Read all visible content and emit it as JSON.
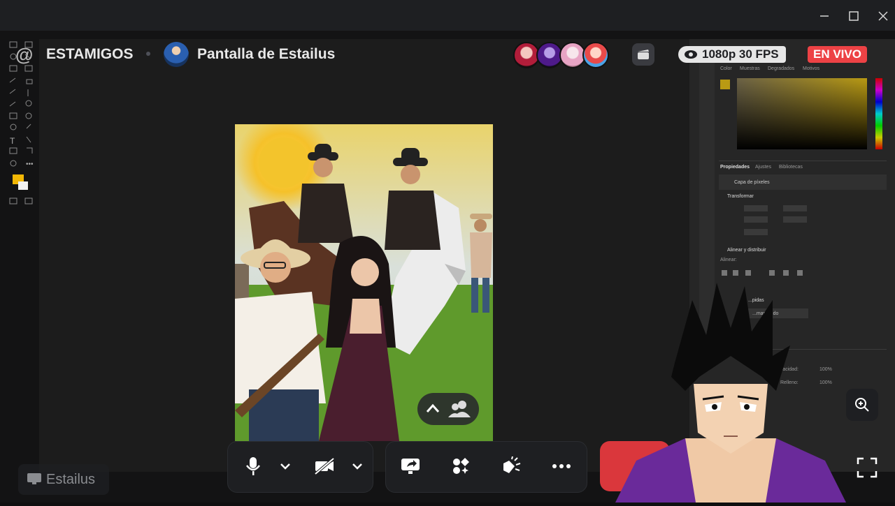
{
  "window": {
    "minimize_icon": "minimize-icon",
    "maximize_icon": "maximize-icon",
    "close_icon": "close-icon"
  },
  "header": {
    "server_name": "ESTAMIGOS",
    "stream_title": "Pantalla de Estailus",
    "quality": "1080p 30 FPS",
    "live_label": "EN VIVO"
  },
  "photoshop_panel": {
    "color_tab": "Color",
    "swatches_tab": "Muestras",
    "gradients_tab": "Degradados",
    "patterns_tab": "Motivos",
    "properties_tab": "Propiedades",
    "adjustments_tab": "Ajustes",
    "libraries_tab": "Bibliotecas",
    "layer_type": "Capa de píxeles",
    "transform": "Transformar",
    "align": "Alinear y distribuir",
    "align_sub": "Alinear:",
    "quick_actions": "...pidas",
    "remove_bg": "...mar fondo",
    "opacity": "Opacidad:",
    "opacity_val": "100%",
    "fill": "Relleno:",
    "fill_val": "100%"
  },
  "controls": {
    "mic": "microphone-icon",
    "camera_off": "camera-off-icon",
    "share_screen": "share-screen-icon",
    "activities": "activities-icon",
    "soundboard": "soundboard-icon",
    "more": "more-icon"
  },
  "streamer": {
    "name": "Estailus"
  },
  "colors": {
    "live_red": "#ed4245",
    "end_call_red": "#da373c",
    "background": "#131314",
    "control_bg": "#1e1f22"
  }
}
